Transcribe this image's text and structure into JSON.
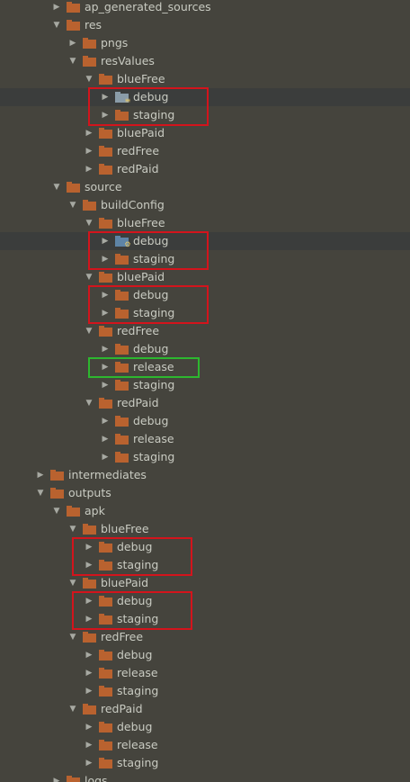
{
  "tree": {
    "rows": [
      {
        "label": "ap_generated_sources",
        "level": 1,
        "expanded": false,
        "icon": "folder-icon"
      },
      {
        "label": "res",
        "level": 1,
        "expanded": true,
        "icon": "folder-icon"
      },
      {
        "label": "pngs",
        "level": 2,
        "expanded": false,
        "icon": "folder-icon"
      },
      {
        "label": "resValues",
        "level": 2,
        "expanded": true,
        "icon": "folder-icon"
      },
      {
        "label": "blueFree",
        "level": 3,
        "expanded": true,
        "icon": "folder-icon"
      },
      {
        "label": "debug",
        "level": 4,
        "expanded": false,
        "icon": "generated-resources-folder-icon",
        "selected": true
      },
      {
        "label": "staging",
        "level": 4,
        "expanded": false,
        "icon": "folder-icon"
      },
      {
        "label": "bluePaid",
        "level": 3,
        "expanded": false,
        "icon": "folder-icon"
      },
      {
        "label": "redFree",
        "level": 3,
        "expanded": false,
        "icon": "folder-icon"
      },
      {
        "label": "redPaid",
        "level": 3,
        "expanded": false,
        "icon": "folder-icon"
      },
      {
        "label": "source",
        "level": 1,
        "expanded": true,
        "icon": "folder-icon"
      },
      {
        "label": "buildConfig",
        "level": 2,
        "expanded": true,
        "icon": "folder-icon"
      },
      {
        "label": "blueFree",
        "level": 3,
        "expanded": true,
        "icon": "folder-icon"
      },
      {
        "label": "debug",
        "level": 4,
        "expanded": false,
        "icon": "source-root-folder-icon",
        "selected": true
      },
      {
        "label": "staging",
        "level": 4,
        "expanded": false,
        "icon": "folder-icon"
      },
      {
        "label": "bluePaid",
        "level": 3,
        "expanded": true,
        "icon": "folder-icon"
      },
      {
        "label": "debug",
        "level": 4,
        "expanded": false,
        "icon": "folder-icon"
      },
      {
        "label": "staging",
        "level": 4,
        "expanded": false,
        "icon": "folder-icon"
      },
      {
        "label": "redFree",
        "level": 3,
        "expanded": true,
        "icon": "folder-icon"
      },
      {
        "label": "debug",
        "level": 4,
        "expanded": false,
        "icon": "folder-icon"
      },
      {
        "label": "release",
        "level": 4,
        "expanded": false,
        "icon": "folder-icon"
      },
      {
        "label": "staging",
        "level": 4,
        "expanded": false,
        "icon": "folder-icon"
      },
      {
        "label": "redPaid",
        "level": 3,
        "expanded": true,
        "icon": "folder-icon"
      },
      {
        "label": "debug",
        "level": 4,
        "expanded": false,
        "icon": "folder-icon"
      },
      {
        "label": "release",
        "level": 4,
        "expanded": false,
        "icon": "folder-icon"
      },
      {
        "label": "staging",
        "level": 4,
        "expanded": false,
        "icon": "folder-icon"
      },
      {
        "label": "intermediates",
        "level": 0,
        "expanded": false,
        "icon": "folder-icon"
      },
      {
        "label": "outputs",
        "level": 0,
        "expanded": true,
        "icon": "folder-icon"
      },
      {
        "label": "apk",
        "level": 1,
        "expanded": true,
        "icon": "folder-icon"
      },
      {
        "label": "blueFree",
        "level": 2,
        "expanded": true,
        "icon": "folder-icon"
      },
      {
        "label": "debug",
        "level": 3,
        "expanded": false,
        "icon": "folder-icon"
      },
      {
        "label": "staging",
        "level": 3,
        "expanded": false,
        "icon": "folder-icon"
      },
      {
        "label": "bluePaid",
        "level": 2,
        "expanded": true,
        "icon": "folder-icon"
      },
      {
        "label": "debug",
        "level": 3,
        "expanded": false,
        "icon": "folder-icon"
      },
      {
        "label": "staging",
        "level": 3,
        "expanded": false,
        "icon": "folder-icon"
      },
      {
        "label": "redFree",
        "level": 2,
        "expanded": true,
        "icon": "folder-icon"
      },
      {
        "label": "debug",
        "level": 3,
        "expanded": false,
        "icon": "folder-icon"
      },
      {
        "label": "release",
        "level": 3,
        "expanded": false,
        "icon": "folder-icon"
      },
      {
        "label": "staging",
        "level": 3,
        "expanded": false,
        "icon": "folder-icon"
      },
      {
        "label": "redPaid",
        "level": 2,
        "expanded": true,
        "icon": "folder-icon"
      },
      {
        "label": "debug",
        "level": 3,
        "expanded": false,
        "icon": "folder-icon"
      },
      {
        "label": "release",
        "level": 3,
        "expanded": false,
        "icon": "folder-icon"
      },
      {
        "label": "staging",
        "level": 3,
        "expanded": false,
        "icon": "folder-icon"
      },
      {
        "label": "logs",
        "level": 1,
        "expanded": false,
        "icon": "folder-icon"
      }
    ]
  },
  "highlights": [
    {
      "color": "#d3141c",
      "rows": [
        5,
        6
      ]
    },
    {
      "color": "#d3141c",
      "rows": [
        13,
        14
      ]
    },
    {
      "color": "#d3141c",
      "rows": [
        16,
        17
      ]
    },
    {
      "color": "#2db72f",
      "rows": [
        20,
        20
      ]
    },
    {
      "color": "#d3141c",
      "rows": [
        30,
        31
      ]
    },
    {
      "color": "#d3141c",
      "rows": [
        33,
        34
      ]
    }
  ],
  "colors": {
    "background": "#45443d",
    "selected_row": "#3b3d3c",
    "folder": "#b9622f",
    "text": "#c9cbc2",
    "highlight_red": "#d3141c",
    "highlight_green": "#2db72f"
  }
}
